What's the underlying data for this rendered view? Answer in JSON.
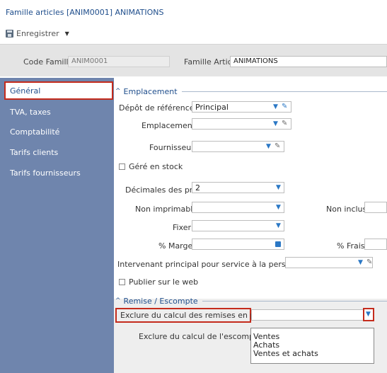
{
  "window": {
    "title": "Famille articles [ANIM0001] ANIMATIONS"
  },
  "toolbar": {
    "save_label": "Enregistrer"
  },
  "header": {
    "code_label": "Code Famille",
    "code_value": "ANIM0001",
    "famille_label": "Famille Articles",
    "famille_value": "ANIMATIONS"
  },
  "sidebar": {
    "items": [
      {
        "label": "Général",
        "active": true
      },
      {
        "label": "TVA, taxes",
        "active": false
      },
      {
        "label": "Comptabilité",
        "active": false
      },
      {
        "label": "Tarifs clients",
        "active": false
      },
      {
        "label": "Tarifs fournisseurs",
        "active": false
      }
    ]
  },
  "emplacement": {
    "section_label": "Emplacement",
    "depot_label": "Dépôt de référence",
    "depot_value": "Principal",
    "emplacement_label": "Emplacement",
    "emplacement_value": "",
    "fournisseur_label": "Fournisseur",
    "fournisseur_value": "",
    "gere_stock_label": "Géré en stock",
    "decimales_label": "Décimales des prix",
    "decimales_value": "2",
    "non_imprimable_label": "Non imprimable",
    "non_imprimable_value": "",
    "non_inclus_label": "Non inclus",
    "fixer_label": "Fixer",
    "fixer_value": "",
    "marge_label": "% Marge",
    "frais_label": "% Frais",
    "intervenant_label": "Intervenant principal pour service à la personne",
    "intervenant_value": "",
    "publier_label": "Publier sur le web"
  },
  "remise": {
    "section_label": "Remise / Escompte",
    "remises_label": "Exclure du calcul des remises en pied",
    "remises_value": "",
    "escompte_label": "Exclure du calcul de l'escompte",
    "options": [
      "Ventes",
      "Achats",
      "Ventes et achats"
    ]
  },
  "colors": {
    "accent": "#1f4e8c",
    "sidebar": "#6f85ad",
    "highlight": "#c42b1c"
  }
}
